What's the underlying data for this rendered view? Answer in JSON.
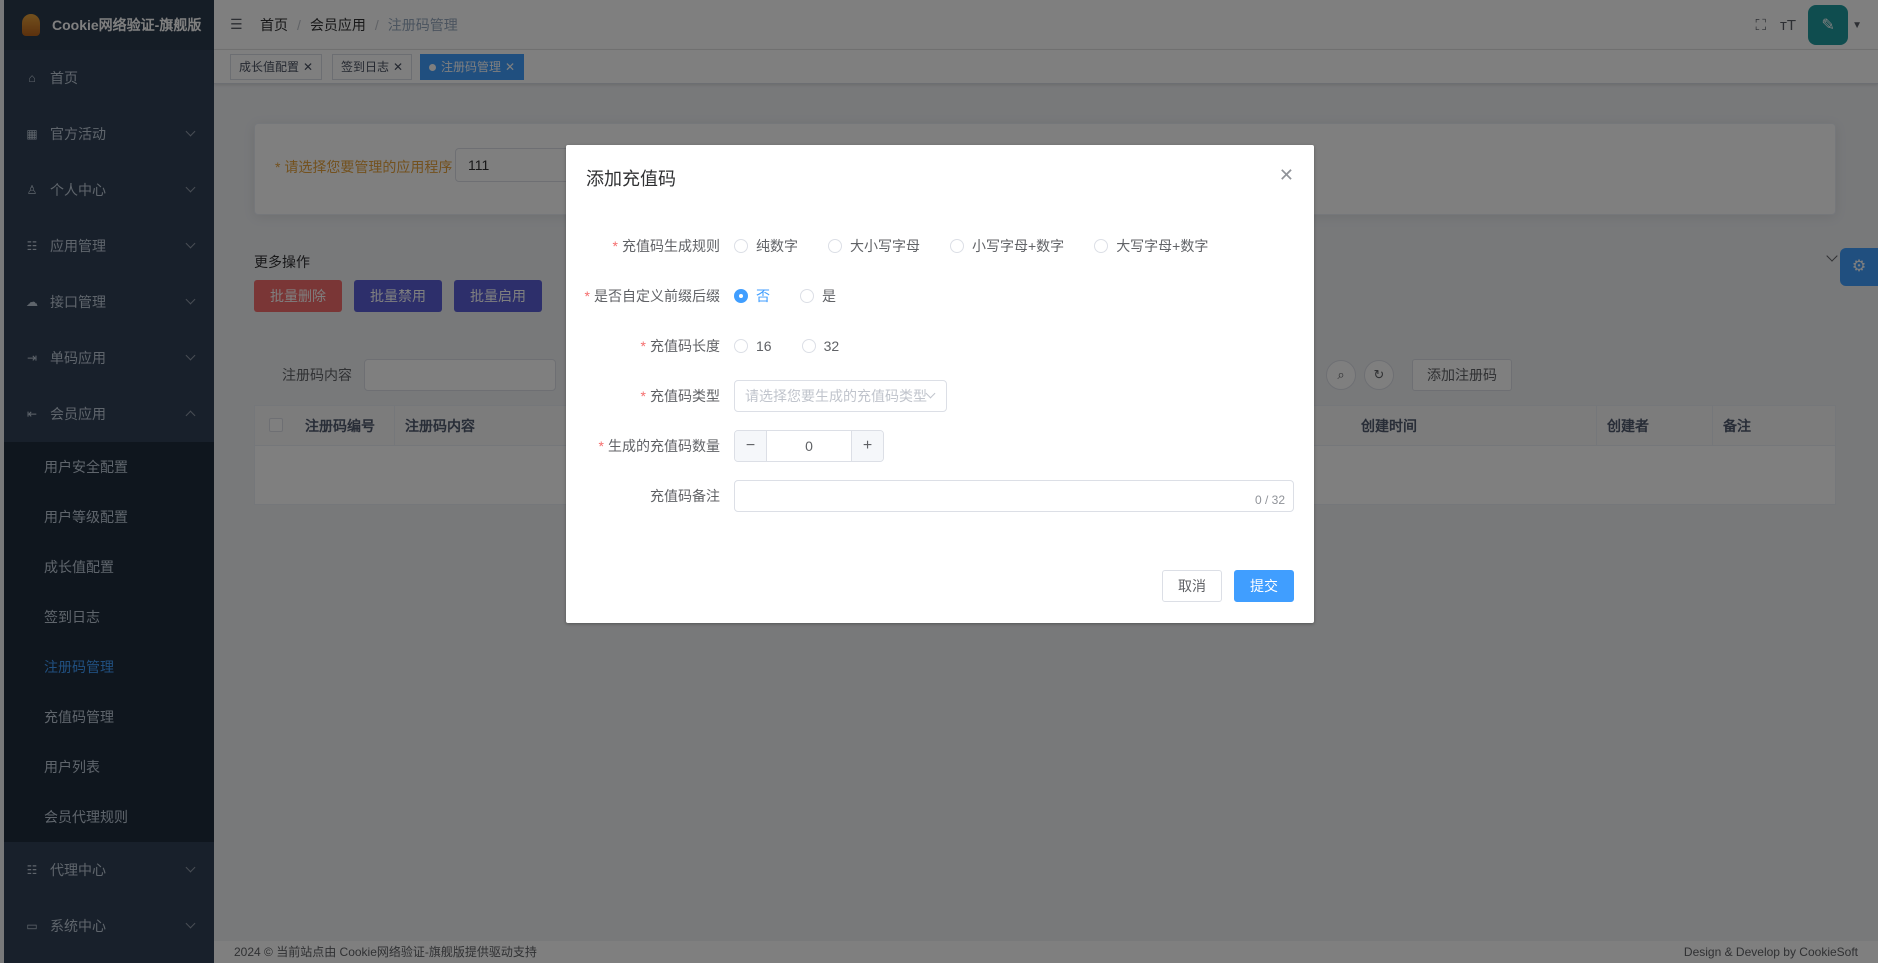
{
  "brand": {
    "title": "Cookie网络验证-旗舰版"
  },
  "sidebar": {
    "items": [
      {
        "label": "首页",
        "icon": "home-icon"
      },
      {
        "label": "官方活动",
        "icon": "grid-icon"
      },
      {
        "label": "个人中心",
        "icon": "user-icon"
      },
      {
        "label": "应用管理",
        "icon": "tree-icon"
      },
      {
        "label": "接口管理",
        "icon": "cloud-icon"
      },
      {
        "label": "单码应用",
        "icon": "login-icon"
      },
      {
        "label": "会员应用",
        "icon": "logout-icon"
      }
    ],
    "sub_items": [
      {
        "label": "用户安全配置"
      },
      {
        "label": "用户等级配置"
      },
      {
        "label": "成长值配置"
      },
      {
        "label": "签到日志"
      },
      {
        "label": "注册码管理",
        "active": true
      },
      {
        "label": "充值码管理"
      },
      {
        "label": "用户列表"
      },
      {
        "label": "会员代理规则"
      }
    ],
    "bottom_items": [
      {
        "label": "代理中心",
        "icon": "tree-icon"
      },
      {
        "label": "系统中心",
        "icon": "monitor-icon"
      }
    ]
  },
  "breadcrumb": [
    "首页",
    "会员应用",
    "注册码管理"
  ],
  "tags": [
    {
      "label": "成长值配置"
    },
    {
      "label": "签到日志"
    },
    {
      "label": "注册码管理",
      "active": true
    }
  ],
  "app_select": {
    "label": "请选择您要管理的应用程序",
    "value": "111"
  },
  "ops": {
    "title": "更多操作",
    "batch_delete": "批量删除",
    "batch_disable": "批量禁用",
    "batch_enable": "批量启用",
    "search_label": "注册码内容",
    "add_button": "添加注册码"
  },
  "table": {
    "headers": [
      "注册码编号",
      "注册码内容",
      "创建时间",
      "创建者",
      "备注"
    ]
  },
  "footer": {
    "left": "2024 © 当前站点由 Cookie网络验证-旗舰版提供驱动支持",
    "right": "Design & Develop by CookieSoft"
  },
  "dialog": {
    "title": "添加充值码",
    "rule_label": "充值码生成规则",
    "rule_options": [
      "纯数字",
      "大小写字母",
      "小写字母+数字",
      "大写字母+数字"
    ],
    "prefix_label": "是否自定义前缀后缀",
    "prefix_options": [
      "否",
      "是"
    ],
    "prefix_selected": "否",
    "length_label": "充值码长度",
    "length_options": [
      "16",
      "32"
    ],
    "type_label": "充值码类型",
    "type_placeholder": "请选择您要生成的充值码类型",
    "count_label": "生成的充值码数量",
    "count_value": "0",
    "remark_label": "充值码备注",
    "remark_count": "0 / 32",
    "cancel": "取消",
    "submit": "提交"
  },
  "colors": {
    "primary": "#409eff",
    "sidebar": "#304156",
    "danger": "#f56c6c",
    "accent_label": "#e6a23c"
  }
}
